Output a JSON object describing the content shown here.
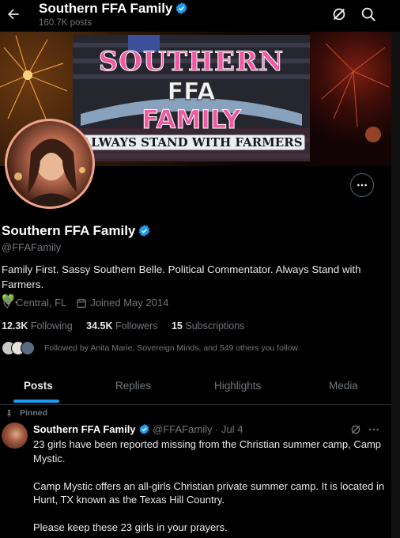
{
  "header": {
    "name": "Southern FFA Family",
    "post_count": "160.7K posts"
  },
  "banner": {
    "line1": "SOUTHERN",
    "line2": "FFA",
    "line3": "FAMILY",
    "line4": "ALWAYS STAND WITH FARMERS"
  },
  "profile": {
    "name": "Southern FFA Family",
    "handle": "@FFAFamily",
    "bio": "Family First. Sassy Southern Belle. Political Commentator. Always Stand with Farmers.",
    "bio_emoji": "💚",
    "bio_end": ".",
    "location": "Central, FL",
    "joined": "Joined May 2014",
    "following_count": "12.3K",
    "following_label": "Following",
    "followers_count": "34.5K",
    "followers_label": "Followers",
    "subs_count": "15",
    "subs_label": "Subscriptions",
    "followed_by": "Followed by Anita Marie, Sovereign Minds, and 549 others you follow"
  },
  "tabs": [
    "Posts",
    "Replies",
    "Highlights",
    "Media"
  ],
  "post": {
    "pinned_label": "Pinned",
    "author": "Southern FFA Family",
    "meta": "@FFAFamily · Jul 4",
    "paragraphs": [
      "23 girls have been reported missing from the Christian summer camp, Camp Mystic.",
      "Camp Mystic offers an all-girls Christian private summer camp. It is located in Hunt, TX known as the Texas Hill Country.",
      "Please keep these 23 girls in your prayers."
    ]
  },
  "colors": {
    "accent": "#1d9bf0",
    "banner_pink": "#f05aa0"
  },
  "icons": [
    "back-arrow-icon",
    "grok-icon",
    "search-icon",
    "verified-icon",
    "more-icon",
    "location-icon",
    "calendar-icon",
    "pin-icon"
  ]
}
